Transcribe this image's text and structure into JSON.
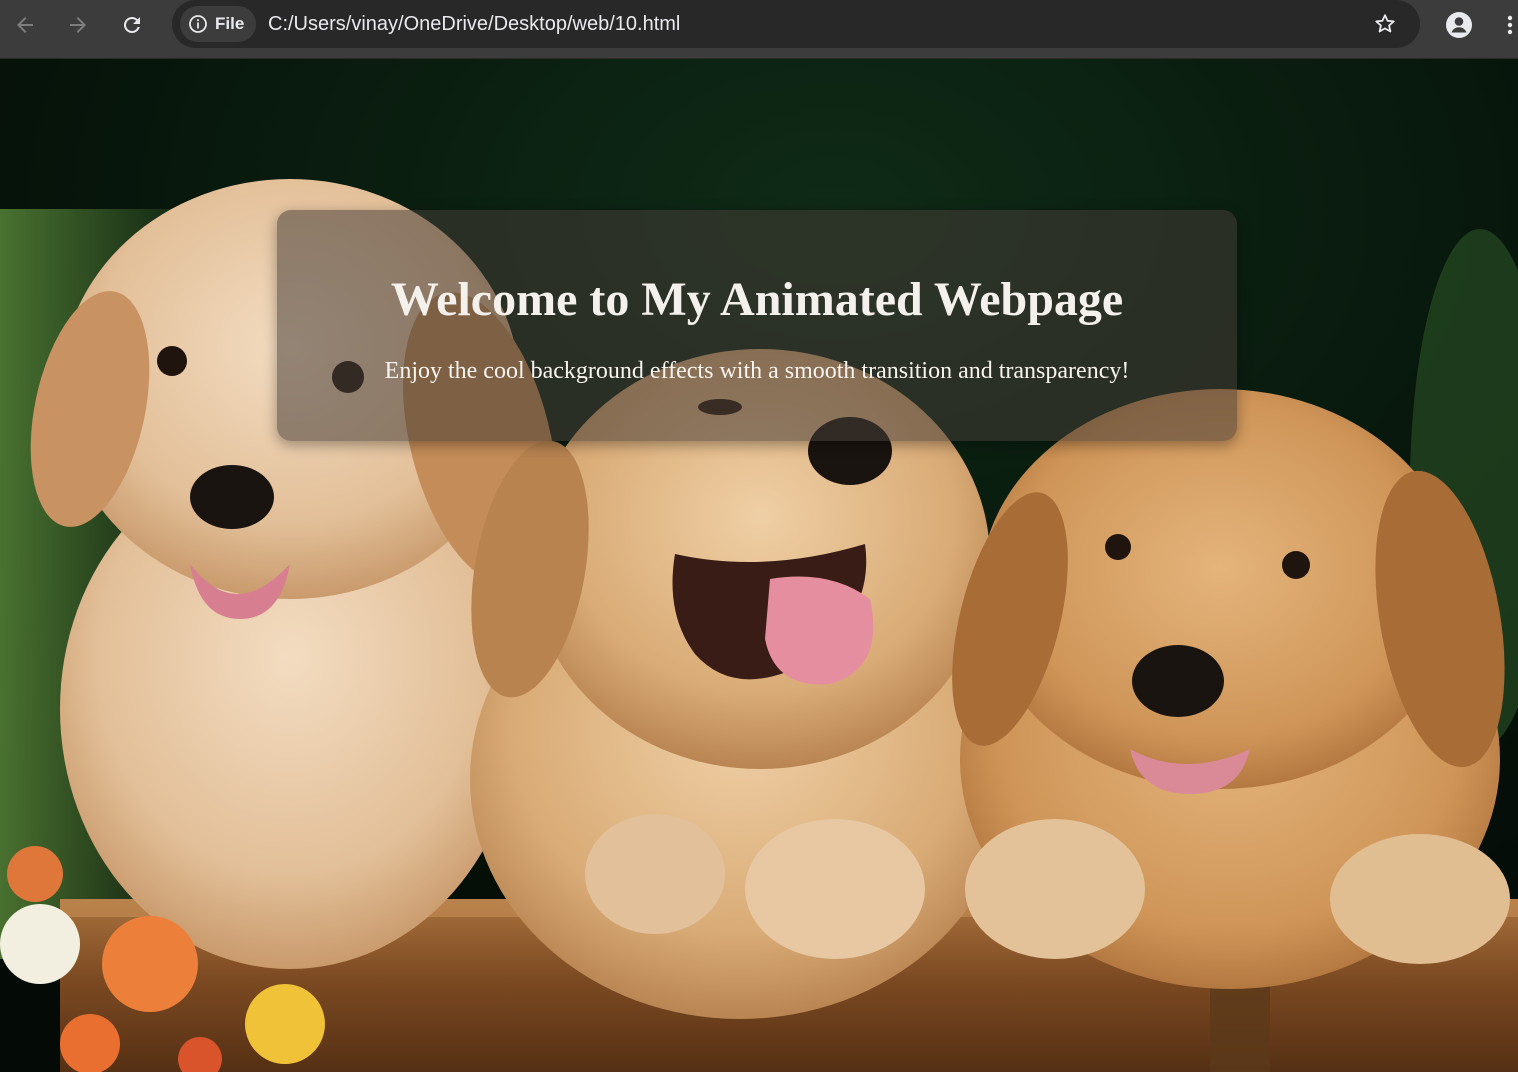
{
  "browser": {
    "site_info_label": "File",
    "url": "C:/Users/vinay/OneDrive/Desktop/web/10.html",
    "icons": {
      "back": "arrow-left-icon",
      "forward": "arrow-right-icon",
      "reload": "reload-icon",
      "info": "info-icon",
      "bookmark": "star-icon",
      "profile": "person-icon",
      "menu": "kebab-menu-icon"
    }
  },
  "page": {
    "title": "Welcome to My Animated Webpage",
    "subtitle": "Enjoy the cool background effects with a smooth transition and transparency!",
    "background_image": "three golden retriever puppies leaning over a wooden box"
  },
  "colors": {
    "toolbar": "#3c3c3c",
    "omnibox": "#282828",
    "card_overlay": "rgba(70,60,55,0.55)",
    "text": "#f4f1ec"
  }
}
